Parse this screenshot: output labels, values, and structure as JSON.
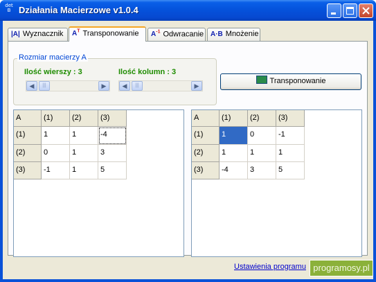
{
  "window": {
    "title": "Działania Macierzowe v1.0.4",
    "icon_text": "det B"
  },
  "tabs": [
    {
      "label": "Wyznacznik",
      "icon": "|A|"
    },
    {
      "label": "Transponowanie",
      "icon": "A",
      "icon_sup": "T"
    },
    {
      "label": "Odwracanie",
      "icon": "A",
      "icon_sup": "-1"
    },
    {
      "label": "Mnożenie",
      "icon": "A·B"
    }
  ],
  "size_group": {
    "title": "Rozmiar macierzy A",
    "rows_label": "Ilość wierszy : 3",
    "cols_label": "Ilość kolumn : 3",
    "rows": 3,
    "cols": 3
  },
  "transpose_button": "Transponowanie",
  "matrix_a": {
    "corner": "A",
    "col_headers": [
      "(1)",
      "(2)",
      "(3)"
    ],
    "rows": [
      {
        "header": "(1)",
        "cells": [
          "1",
          "1",
          "-4"
        ]
      },
      {
        "header": "(2)",
        "cells": [
          "0",
          "1",
          "3"
        ]
      },
      {
        "header": "(3)",
        "cells": [
          "-1",
          "1",
          "5"
        ]
      }
    ]
  },
  "matrix_t": {
    "corner": "A",
    "col_headers": [
      "(1)",
      "(2)",
      "(3)"
    ],
    "rows": [
      {
        "header": "(1)",
        "cells": [
          "1",
          "0",
          "-1"
        ]
      },
      {
        "header": "(2)",
        "cells": [
          "1",
          "1",
          "1"
        ]
      },
      {
        "header": "(3)",
        "cells": [
          "-4",
          "3",
          "5"
        ]
      }
    ]
  },
  "settings_link": "Ustawienia programu",
  "watermark": "programosy.pl",
  "colors": {
    "titlebar": "#0553dc",
    "accent_green": "#1e8c00",
    "group_title": "#0046d5",
    "selection": "#316ac5"
  }
}
